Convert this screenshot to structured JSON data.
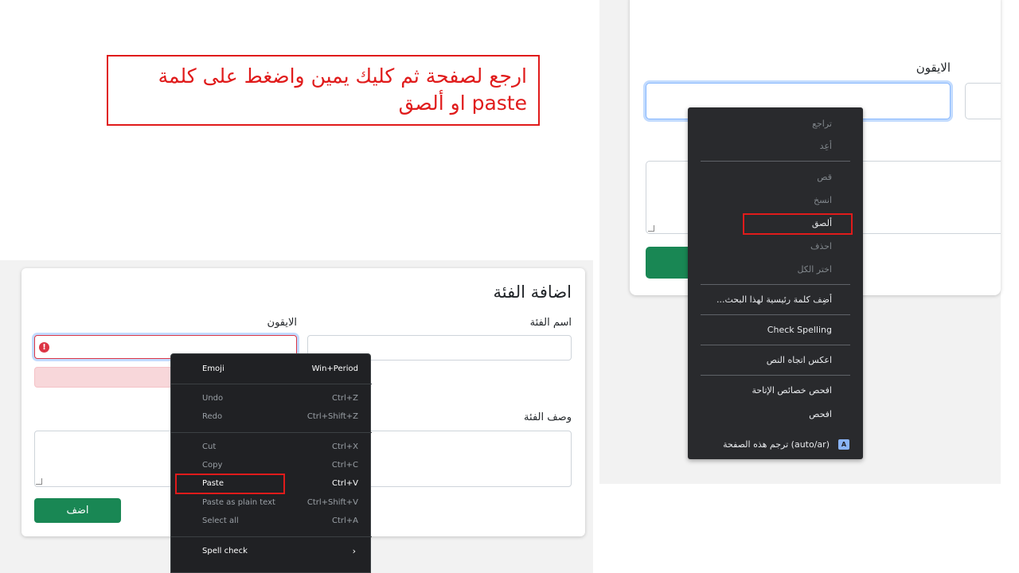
{
  "instruction": {
    "line1": "ارجع لصفحة ثم كليك يمين واضغط على كلمة",
    "line2": "paste او ألصق"
  },
  "left_form": {
    "title": "اضافة الفئة",
    "category_name_label": "اسم الفئة",
    "icon_label": "الايقون",
    "description_label": "وصف الفئة",
    "submit_label": "اضف",
    "error_glyph": "!"
  },
  "left_menu": {
    "emoji": "Emoji",
    "emoji_key": "Win+Period",
    "undo": "Undo",
    "undo_key": "Ctrl+Z",
    "redo": "Redo",
    "redo_key": "Ctrl+Shift+Z",
    "cut": "Cut",
    "cut_key": "Ctrl+X",
    "copy": "Copy",
    "copy_key": "Ctrl+C",
    "paste": "Paste",
    "paste_key": "Ctrl+V",
    "paste_plain": "Paste as plain text",
    "paste_plain_key": "Ctrl+Shift+V",
    "select_all": "Select all",
    "select_all_key": "Ctrl+A",
    "spell_check": "Spell check",
    "chevron": "›"
  },
  "right_form": {
    "icon_label": "الايقون"
  },
  "right_menu": {
    "undo": "تراجع",
    "redo": "أعِد",
    "cut": "قص",
    "copy": "انسخ",
    "paste": "ألصق",
    "delete": "احذف",
    "select_all": "اختر الكل",
    "add_search_keyword": "أضِف كلمة رئيسية لهذا البحث...",
    "check_spelling": "Check Spelling",
    "reverse_direction": "اعكس اتجاه النص",
    "inspect_accessibility": "افحص خصائص الإتاحة",
    "inspect": "افحص",
    "translate": "(auto/ar) ترجم هذه الصفحة",
    "translate_glyph": "A"
  },
  "colors": {
    "highlight": "#e01b1b",
    "primary_green": "#198754",
    "error_red": "#dc3545",
    "menu_bg_left": "#202124",
    "menu_bg_right": "#292a2d"
  }
}
